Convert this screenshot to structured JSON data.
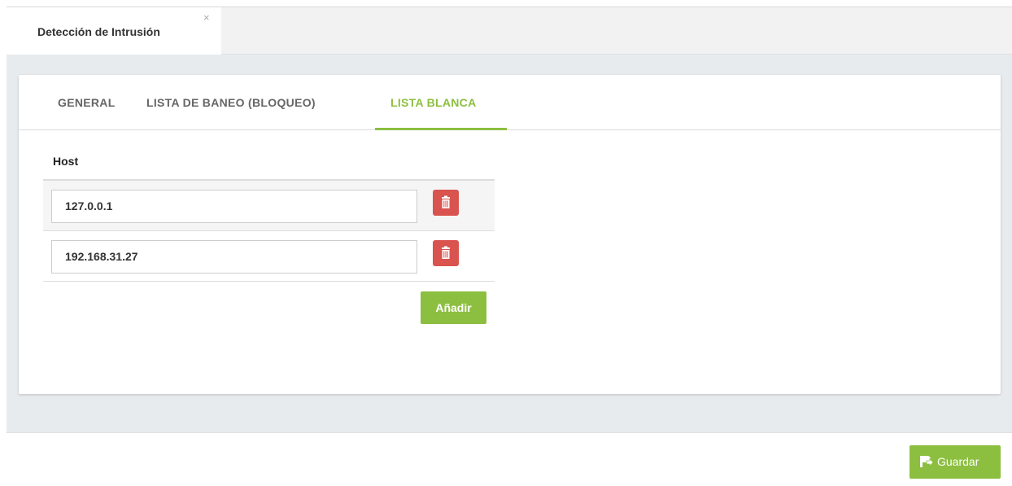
{
  "window": {
    "tab_title": "Detección de Intrusión",
    "close_glyph": "×"
  },
  "tabs": {
    "general": "GENERAL",
    "ban_list": "LISTA DE BANEO (BLOQUEO)",
    "white_list": "LISTA BLANCA",
    "active": "white_list"
  },
  "table": {
    "header": "Host",
    "rows": [
      {
        "host": "127.0.0.1",
        "action_icon": "trash-icon"
      },
      {
        "host": "192.168.31.27",
        "action_icon": "trash-icon"
      }
    ]
  },
  "buttons": {
    "add_label": "Añadir",
    "save_label": "Guardar",
    "save_icon": "save-share-icon"
  },
  "colors": {
    "accent": "#8cbf3f",
    "danger": "#d9534f",
    "background": "#e8ebee"
  }
}
